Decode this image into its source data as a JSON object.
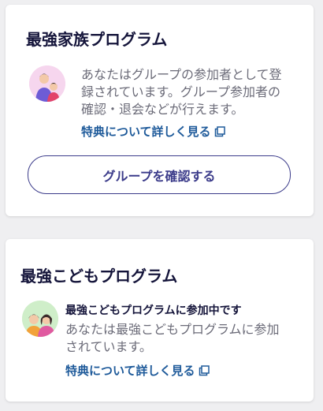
{
  "family_program": {
    "title": "最強家族プログラム",
    "description_lines": [
      "あなたはグループの参加者として登",
      "録されています。グループ参加者の",
      "確認・退会などが行えます。"
    ],
    "link_label": "特典について詳しく見る",
    "button_label": "グループを確認する",
    "avatar_icon": "family-icon"
  },
  "kids_program": {
    "title": "最強こどもプログラム",
    "status": "最強こどもプログラムに参加中です",
    "description_lines": [
      "あなたは最強こどもプログラムに参加",
      "されています。"
    ],
    "link_label": "特典について詳しく見る",
    "avatar_icon": "kids-icon"
  },
  "colors": {
    "background": "#efeff1",
    "card": "#ffffff",
    "title": "#14143a",
    "link": "#1e5a9a",
    "button_outline": "#3b3b8a",
    "avatar_family_bg": "#f6d6ee",
    "avatar_kids_bg": "#cfeec9"
  }
}
